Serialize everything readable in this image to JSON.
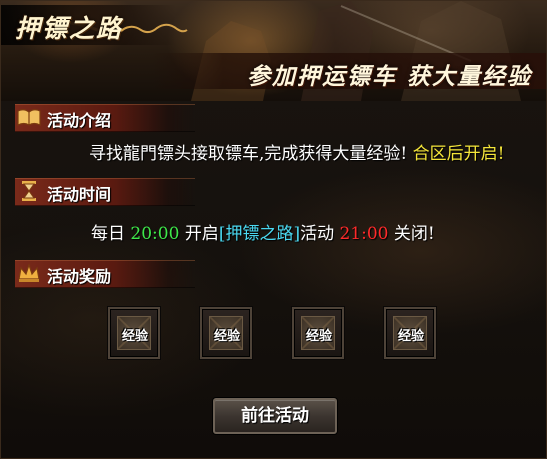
{
  "banner": {
    "title": "押镖之路",
    "slogan": "参加押运镖车 获大量经验"
  },
  "sections": {
    "intro": {
      "header": "活动介绍",
      "icon": "book-icon",
      "text": "寻找龍門镖头接取镖车,完成获得大量经验!",
      "highlight": "合区后开启!"
    },
    "time": {
      "header": "活动时间",
      "icon": "hourglass-icon",
      "daily": "每日",
      "start_time": "20:00",
      "open": "开启",
      "event_name": "[押镖之路]",
      "activity": "活动",
      "end_time": "21:00",
      "close": "关闭!"
    },
    "rewards": {
      "header": "活动奖励",
      "icon": "crown-icon",
      "items": [
        {
          "label": "经验"
        },
        {
          "label": "经验"
        },
        {
          "label": "经验"
        },
        {
          "label": "经验"
        }
      ]
    }
  },
  "go_button": "前往活动",
  "colors": {
    "highlight_yellow": "#f5e63a",
    "start_green": "#3ee84a",
    "event_cyan": "#4ad8f0",
    "end_red": "#ff2a2a",
    "text": "#f2e8d0",
    "header_bar": "#7a2a1a"
  }
}
